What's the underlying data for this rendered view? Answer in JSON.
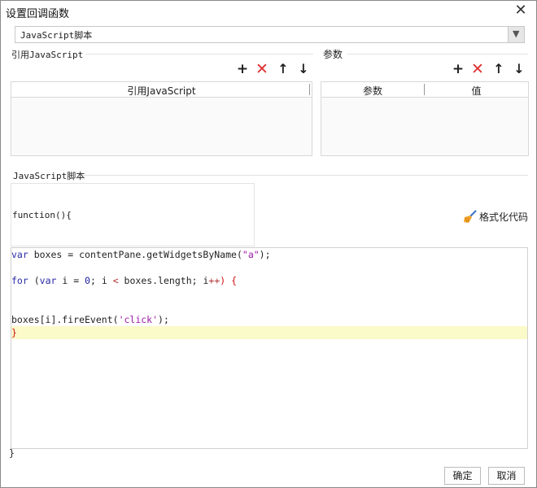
{
  "window": {
    "title": "设置回调函数"
  },
  "script_type": {
    "selected": "JavaScript脚本"
  },
  "ref_section": {
    "label": "引用JavaScript",
    "column": "引用JavaScript"
  },
  "param_section": {
    "label": "参数",
    "columns": [
      "参数",
      "值"
    ]
  },
  "toolbar": {
    "add": "+",
    "delete": "✕",
    "up": "🡑",
    "down": "🡓"
  },
  "script_section": {
    "label": "JavaScript脚本"
  },
  "function_header": "function(){",
  "format_button": "格式化代码",
  "code": {
    "line1_a": "var",
    "line1_b": " boxes = contentPane.getWidgetsByName(",
    "line1_c": "\"a\"",
    "line1_d": ");",
    "line2_a": "for",
    "line2_b": " (",
    "line2_c": "var",
    "line2_d": " i = ",
    "line2_e": "0",
    "line2_f": "; i ",
    "line2_g": "<",
    "line2_h": " boxes.length; i",
    "line2_i": "++",
    "line2_j": ") {",
    "line3_a": "boxes[i].fireEvent(",
    "line3_b": "'click'",
    "line3_c": ");",
    "line4": "}"
  },
  "function_footer": "}",
  "buttons": {
    "ok": "确定",
    "cancel": "取消"
  }
}
